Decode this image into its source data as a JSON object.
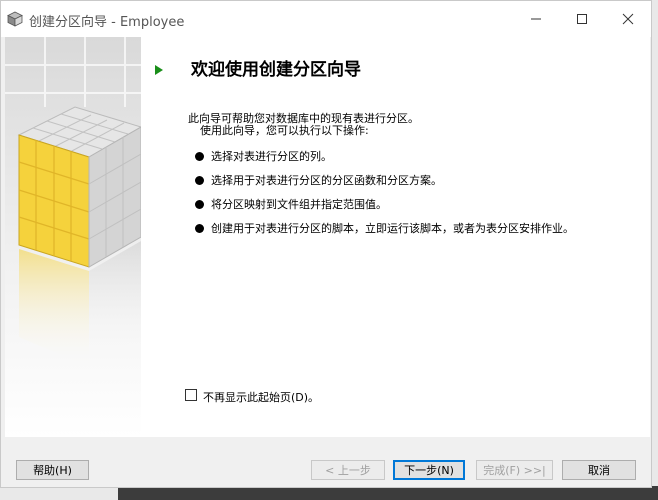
{
  "window": {
    "title": "创建分区向导 - Employee",
    "app_icon": "cube-icon"
  },
  "header": {
    "title": "欢迎使用创建分区向导",
    "arrow_icon": "green-arrow-icon"
  },
  "intro": {
    "line1": "此向导可帮助您对数据库中的现有表进行分区。",
    "line2": "使用此向导，您可以执行以下操作:"
  },
  "bullets": [
    "选择对表进行分区的列。",
    "选择用于对表进行分区的分区函数和分区方案。",
    "将分区映射到文件组并指定范围值。",
    "创建用于对表进行分区的脚本，立即运行该脚本，或者为表分区安排作业。"
  ],
  "checkbox": {
    "label": "不再显示此起始页(D)。",
    "checked": false
  },
  "buttons": {
    "help": "帮助(H)",
    "prev": "< 上一步",
    "next": "下一步(N)",
    "finish": "完成(F) >>|",
    "cancel": "取消"
  },
  "colors": {
    "accent": "#0078d7",
    "cube_yellow": "#f5d23c",
    "arrow_green": "#1a8f1a"
  }
}
